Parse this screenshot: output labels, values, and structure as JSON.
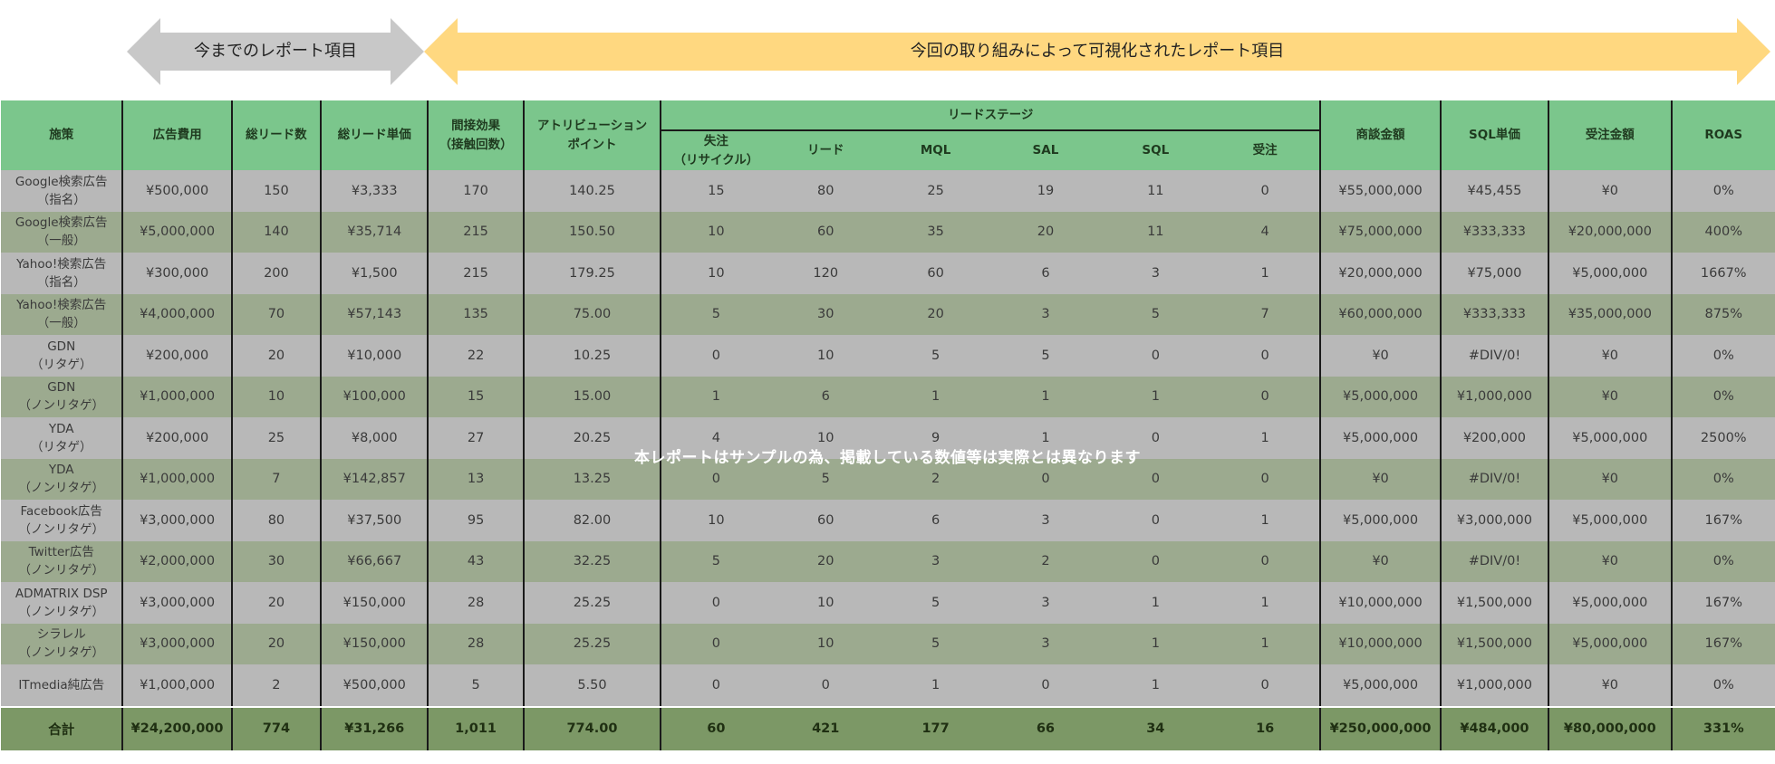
{
  "arrows": {
    "previous_label": "今までのレポート項目",
    "current_label": "今回の取り組みによって可視化されたレポート項目",
    "previous_color": "#c8c8c8",
    "current_color": "#ffd880"
  },
  "table": {
    "headers": {
      "measure": "施策",
      "ad_cost": "広告費用",
      "total_leads": "総リード数",
      "lead_unit_price": "総リード単価",
      "indirect_effect": "間接効果\n（接触回数）",
      "attribution_points": "アトリビューション\nポイント",
      "lead_stage": "リードステージ",
      "lost_recycle": "失注\n（リサイクル）",
      "lead": "リード",
      "mql": "MQL",
      "sal": "SAL",
      "sql": "SQL",
      "won": "受注",
      "deal_amount": "商談金額",
      "sql_unit_price": "SQL単価",
      "won_amount": "受注金額",
      "roas": "ROAS"
    },
    "rows": [
      [
        "Google検索広告\n（指名）",
        "¥500,000",
        "150",
        "¥3,333",
        "170",
        "140.25",
        "15",
        "80",
        "25",
        "19",
        "11",
        "0",
        "¥55,000,000",
        "¥45,455",
        "¥0",
        "0%"
      ],
      [
        "Google検索広告\n（一般）",
        "¥5,000,000",
        "140",
        "¥35,714",
        "215",
        "150.50",
        "10",
        "60",
        "35",
        "20",
        "11",
        "4",
        "¥75,000,000",
        "¥333,333",
        "¥20,000,000",
        "400%"
      ],
      [
        "Yahoo!検索広告\n（指名）",
        "¥300,000",
        "200",
        "¥1,500",
        "215",
        "179.25",
        "10",
        "120",
        "60",
        "6",
        "3",
        "1",
        "¥20,000,000",
        "¥75,000",
        "¥5,000,000",
        "1667%"
      ],
      [
        "Yahoo!検索広告\n（一般）",
        "¥4,000,000",
        "70",
        "¥57,143",
        "135",
        "75.00",
        "5",
        "30",
        "20",
        "3",
        "5",
        "7",
        "¥60,000,000",
        "¥333,333",
        "¥35,000,000",
        "875%"
      ],
      [
        "GDN\n（リタゲ）",
        "¥200,000",
        "20",
        "¥10,000",
        "22",
        "10.25",
        "0",
        "10",
        "5",
        "5",
        "0",
        "0",
        "¥0",
        "#DIV/0!",
        "¥0",
        "0%"
      ],
      [
        "GDN\n（ノンリタゲ）",
        "¥1,000,000",
        "10",
        "¥100,000",
        "15",
        "15.00",
        "1",
        "6",
        "1",
        "1",
        "1",
        "0",
        "¥5,000,000",
        "¥1,000,000",
        "¥0",
        "0%"
      ],
      [
        "YDA\n（リタゲ）",
        "¥200,000",
        "25",
        "¥8,000",
        "27",
        "20.25",
        "4",
        "10",
        "9",
        "1",
        "0",
        "1",
        "¥5,000,000",
        "¥200,000",
        "¥5,000,000",
        "2500%"
      ],
      [
        "YDA\n（ノンリタゲ）",
        "¥1,000,000",
        "7",
        "¥142,857",
        "13",
        "13.25",
        "0",
        "5",
        "2",
        "0",
        "0",
        "0",
        "¥0",
        "#DIV/0!",
        "¥0",
        "0%"
      ],
      [
        "Facebook広告\n（ノンリタゲ）",
        "¥3,000,000",
        "80",
        "¥37,500",
        "95",
        "82.00",
        "10",
        "60",
        "6",
        "3",
        "0",
        "1",
        "¥5,000,000",
        "¥3,000,000",
        "¥5,000,000",
        "167%"
      ],
      [
        "Twitter広告\n（ノンリタゲ）",
        "¥2,000,000",
        "30",
        "¥66,667",
        "43",
        "32.25",
        "5",
        "20",
        "3",
        "2",
        "0",
        "0",
        "¥0",
        "#DIV/0!",
        "¥0",
        "0%"
      ],
      [
        "ADMATRIX DSP\n（ノンリタゲ）",
        "¥3,000,000",
        "20",
        "¥150,000",
        "28",
        "25.25",
        "0",
        "10",
        "5",
        "3",
        "1",
        "1",
        "¥10,000,000",
        "¥1,500,000",
        "¥5,000,000",
        "167%"
      ],
      [
        "シラレル\n（ノンリタゲ）",
        "¥3,000,000",
        "20",
        "¥150,000",
        "28",
        "25.25",
        "0",
        "10",
        "5",
        "3",
        "1",
        "1",
        "¥10,000,000",
        "¥1,500,000",
        "¥5,000,000",
        "167%"
      ],
      [
        "ITmedia純広告",
        "¥1,000,000",
        "2",
        "¥500,000",
        "5",
        "5.50",
        "0",
        "0",
        "1",
        "0",
        "1",
        "0",
        "¥5,000,000",
        "¥1,000,000",
        "¥0",
        "0%"
      ]
    ],
    "total": [
      "合計",
      "¥24,200,000",
      "774",
      "¥31,266",
      "1,011",
      "774.00",
      "60",
      "421",
      "177",
      "66",
      "34",
      "16",
      "¥250,000,000",
      "¥484,000",
      "¥80,000,000",
      "331%"
    ]
  },
  "watermark": "本レポートはサンプルの為、掲載している数値等は実際とは異なります",
  "colors": {
    "header_green": "#7bc68c",
    "row_gray": "#b8b8b8",
    "row_green_gray": "#9caa8f",
    "total_green": "#7c9866"
  }
}
